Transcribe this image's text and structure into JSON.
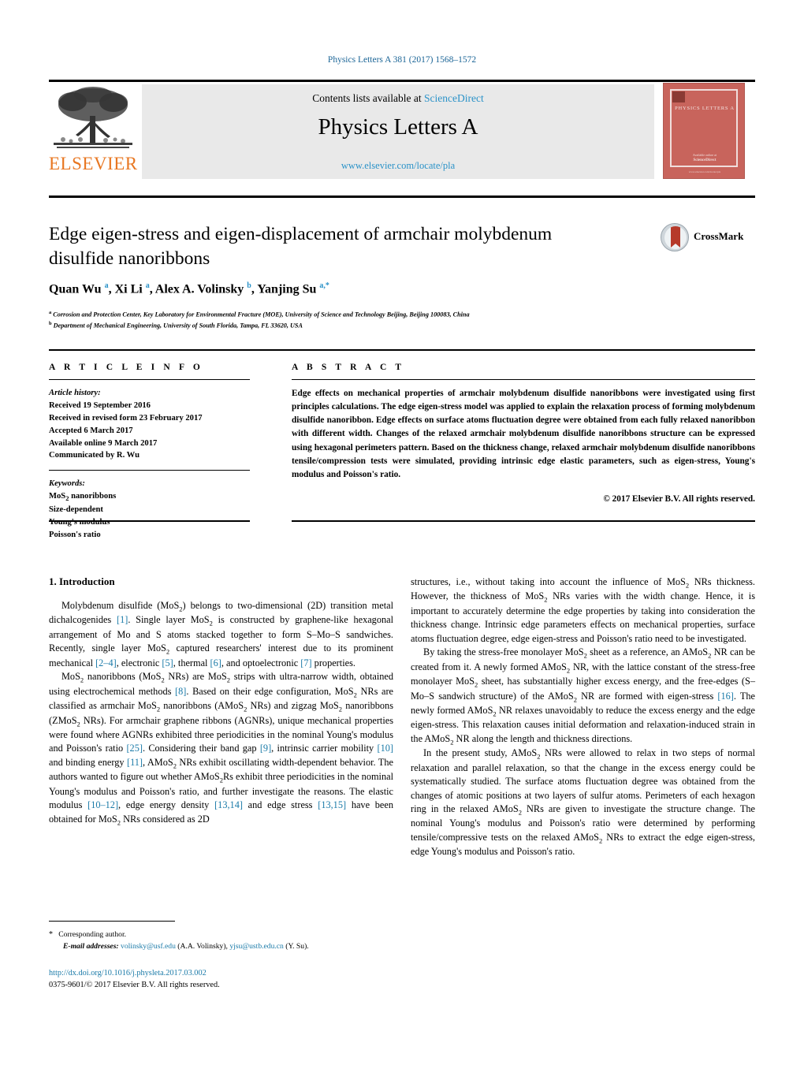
{
  "running_head": "Physics Letters A 381 (2017) 1568–1572",
  "masthead": {
    "contents_prefix": "Contents lists available at ",
    "sciencedirect": "ScienceDirect",
    "journal_title": "Physics Letters A",
    "journal_url": "www.elsevier.com/locate/pla",
    "publisher_logo_text": "ELSEVIER",
    "publisher_logo_icon": "elsevier-tree-icon"
  },
  "cover": {
    "title": "PHYSICS LETTERS A",
    "footer_line1": "Available online at",
    "footer_line2": "ScienceDirect",
    "bottom_text": "www.elsevier.com/locate/pla"
  },
  "article": {
    "title": "Edge eigen-stress and eigen-displacement of armchair molybdenum disulfide nanoribbons",
    "authors_html": "Quan Wu <sup>a</sup>, Xi Li <sup>a</sup>, Alex A. Volinsky <sup>b</sup>, Yanjing Su <sup>a,*</sup>",
    "affiliation_a": "Corrosion and Protection Center, Key Laboratory for Environmental Fracture (MOE), University of Science and Technology Beijing, Beijing 100083, China",
    "affiliation_b": "Department of Mechanical Engineering, University of South Florida, Tampa, FL 33620, USA",
    "crossmark_label": "CrossMark",
    "crossmark_icon": "crossmark-icon"
  },
  "info": {
    "heading": "A R T I C L E    I N F O",
    "history_label": "Article history:",
    "history": [
      "Received 19 September 2016",
      "Received in revised form 23 February 2017",
      "Accepted 6 March 2017",
      "Available online 9 March 2017",
      "Communicated by R. Wu"
    ],
    "keywords_label": "Keywords:",
    "keywords": [
      "MoS2 nanoribbons",
      "Size-dependent",
      "Young's modulus",
      "Poisson's ratio"
    ]
  },
  "abstract": {
    "heading": "A B S T R A C T",
    "body": "Edge effects on mechanical properties of armchair molybdenum disulfide nanoribbons were investigated using first principles calculations. The edge eigen-stress model was applied to explain the relaxation process of forming molybdenum disulfide nanoribbon. Edge effects on surface atoms fluctuation degree were obtained from each fully relaxed nanoribbon with different width. Changes of the relaxed armchair molybdenum disulfide nanoribbons structure can be expressed using hexagonal perimeters pattern. Based on the thickness change, relaxed armchair molybdenum disulfide nanoribbons tensile/compression tests were simulated, providing intrinsic edge elastic parameters, such as eigen-stress, Young's modulus and Poisson's ratio.",
    "copyright": "© 2017 Elsevier B.V. All rights reserved."
  },
  "sections": {
    "intro_heading": "1. Introduction"
  },
  "footnote": {
    "star": "*",
    "corresponding": "Corresponding author.",
    "email_label": "E-mail addresses:",
    "email1": "volinsky@usf.edu",
    "email1_owner": "(A.A. Volinsky),",
    "email2": "yjsu@ustb.edu.cn",
    "email2_owner": "(Y. Su)."
  },
  "doi": {
    "url": "http://dx.doi.org/10.1016/j.physleta.2017.03.002",
    "issn_line": "0375-9601/© 2017 Elsevier B.V. All rights reserved."
  },
  "colors": {
    "link_blue": "#1a7aa8",
    "sciencedirect_blue": "#2a92c8",
    "elsevier_orange": "#e87722",
    "cover_red": "#c8645c"
  }
}
